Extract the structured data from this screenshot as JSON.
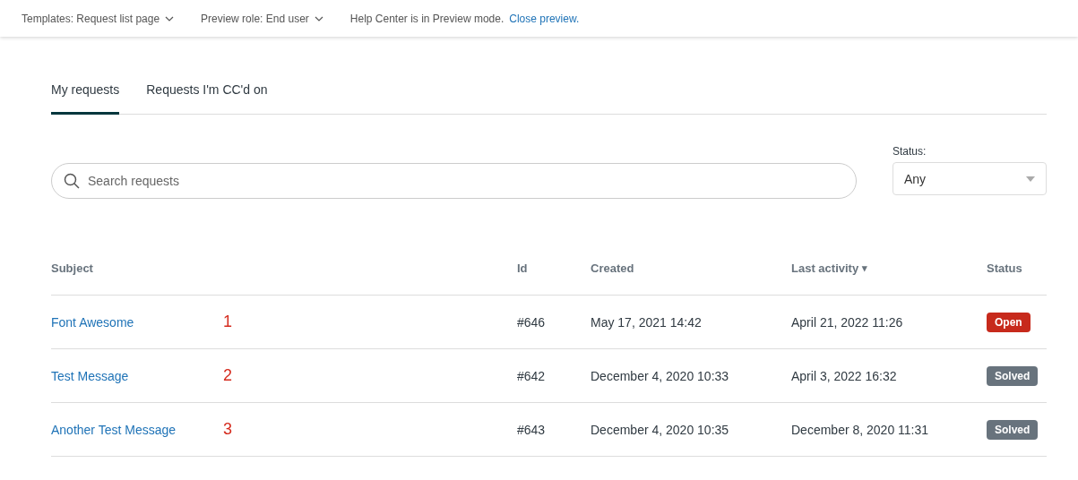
{
  "preview_bar": {
    "template": "Templates: Request list page",
    "role": "Preview role: End user",
    "message": "Help Center is in Preview mode.",
    "link": "Close preview."
  },
  "tabs": [
    {
      "label": "My requests",
      "selected": true
    },
    {
      "label": "Requests I'm CC'd on",
      "selected": false
    }
  ],
  "search": {
    "placeholder": "Search requests"
  },
  "status_filter": {
    "label": "Status:",
    "value": "Any"
  },
  "table": {
    "columns": [
      {
        "label": "Subject"
      },
      {
        "label": "Id"
      },
      {
        "label": "Created"
      },
      {
        "label": "Last activity",
        "sort_indicator": "▾"
      },
      {
        "label": "Status"
      }
    ],
    "rows": [
      {
        "subject": "Font Awesome",
        "annotation": "1",
        "id": "#646",
        "created": "May 17, 2021 14:42",
        "last_activity": "April 21, 2022 11:26",
        "status": {
          "label": "Open",
          "kind": "open"
        }
      },
      {
        "subject": "Test Message",
        "annotation": "2",
        "id": "#642",
        "created": "December 4, 2020 10:33",
        "last_activity": "April 3, 2022 16:32",
        "status": {
          "label": "Solved",
          "kind": "solved"
        }
      },
      {
        "subject": "Another Test Message",
        "annotation": "3",
        "id": "#643",
        "created": "December 4, 2020 10:35",
        "last_activity": "December 8, 2020 11:31",
        "status": {
          "label": "Solved",
          "kind": "solved"
        }
      }
    ]
  }
}
